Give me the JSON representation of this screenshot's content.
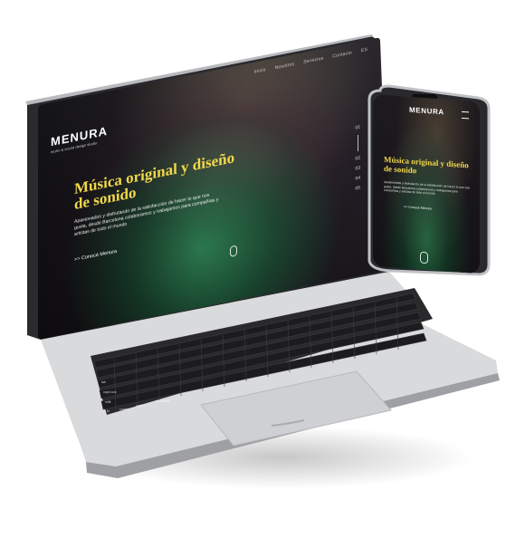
{
  "laptop": {
    "nav_items": [
      "Inicio",
      "Nosotros",
      "Servicios",
      "Contacto",
      "ES"
    ],
    "logo_text": "MENURA",
    "logo_tagline": "music & sound design studio",
    "hero": {
      "title": "Música original y diseño de sonido",
      "text": "Apasionados y disfrutando de la satisfacción de hacer lo que nos gusta, desde Barcelona colaboramos y trabajamos para compañías y artistas de todo el mundo",
      "cta": ">> Conocé Menura"
    },
    "slide_numbers": [
      "01",
      "02",
      "03",
      "04",
      "05"
    ],
    "keyboard_labels": {
      "tab": "tab",
      "caps_lock": "caps lock",
      "shift": "shift",
      "fn": "fn",
      "control": "control",
      "option": "option",
      "command": "command"
    }
  },
  "phone": {
    "logo_text": "MENURA",
    "hero": {
      "title": "Música original y diseño de sonido",
      "text": "Apasionados y disfrutando de la satisfacción de hacer lo que nos gusta, desde Barcelona colaboramos y trabajamos para compañías y artistas de todo el mundo",
      "cta": ">> Conocé Menura"
    }
  },
  "colors": {
    "accent_yellow": "#f1d84a",
    "laptop_silver": "#d9dadc",
    "screen_dark": "#1e1a20",
    "character_green": "#3ab270"
  },
  "icons": [
    "scroll-mouse-icon",
    "menu-icon"
  ]
}
